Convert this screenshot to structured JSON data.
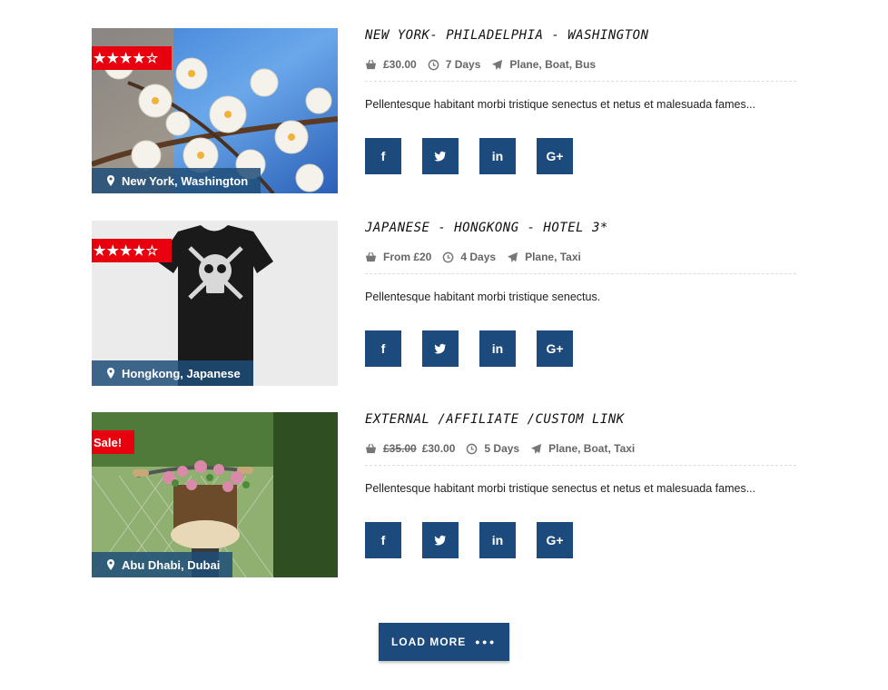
{
  "tours": [
    {
      "title": "NEW YORK- PHILADELPHIA - WASHINGTON",
      "badge_type": "rating",
      "rating": 4,
      "rating_text": "★★★★☆",
      "price_old": "",
      "price": "£30.00",
      "duration": "7 Days",
      "transport": "Plane, Boat, Bus",
      "description": "Pellentesque habitant morbi tristique senectus et netus et malesuada fames...",
      "location": "New York, Washington",
      "image_icon": "cherry-blossom-photo"
    },
    {
      "title": "JAPANESE - HONGKONG - HOTEL 3*",
      "badge_type": "rating",
      "rating": 4.5,
      "rating_text": "★★★★☆",
      "price_old": "",
      "price": "From £20",
      "duration": "4 Days",
      "transport": "Plane, Taxi",
      "description": "Pellentesque habitant morbi tristique senectus.",
      "location": "Hongkong, Japanese",
      "image_icon": "black-tshirt-photo"
    },
    {
      "title": "EXTERNAL /AFFILIATE /CUSTOM LINK",
      "badge_type": "sale",
      "badge_text": "Sale!",
      "price_old": "£35.00",
      "price": "£30.00",
      "duration": "5 Days",
      "transport": "Plane, Boat, Taxi",
      "description": "Pellentesque habitant morbi tristique senectus et netus et malesuada fames...",
      "location": "Abu Dhabi, Dubai",
      "image_icon": "bicycle-flowers-photo"
    }
  ],
  "social": [
    {
      "icon": "facebook-icon",
      "label": "f"
    },
    {
      "icon": "twitter-icon",
      "label": ""
    },
    {
      "icon": "linkedin-icon",
      "label": "in"
    },
    {
      "icon": "google-plus-icon",
      "label": "G+"
    }
  ],
  "load_more": {
    "label": "LOAD MORE",
    "dots": "•••"
  },
  "colors": {
    "accent": "#1c4a7c",
    "ribbon": "#e8000f",
    "location_bg": "#1e4e78"
  }
}
